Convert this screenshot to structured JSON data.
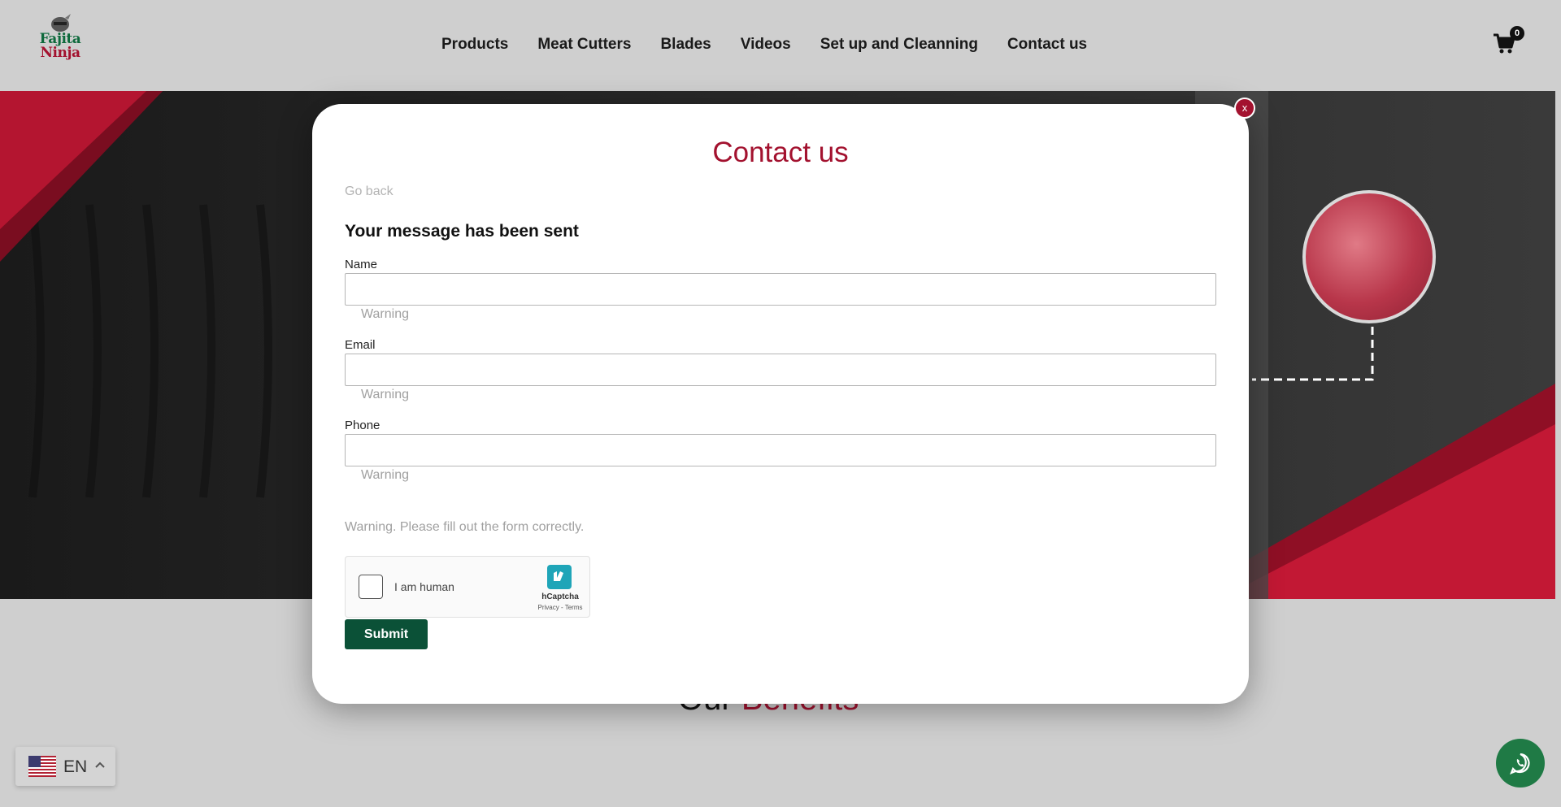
{
  "header": {
    "logo_line1": "Fajita",
    "logo_line2": "Ninja",
    "nav": [
      "Products",
      "Meat Cutters",
      "Blades",
      "Videos",
      "Set up and Cleanning",
      "Contact us"
    ],
    "cart_count": "0"
  },
  "modal": {
    "title": "Contact us",
    "go_back": "Go back",
    "sent_message": "Your message has been sent",
    "close_label": "x",
    "fields": [
      {
        "label": "Name",
        "value": "",
        "warning": "Warning"
      },
      {
        "label": "Email",
        "value": "",
        "warning": "Warning"
      },
      {
        "label": "Phone",
        "value": "",
        "warning": "Warning"
      }
    ],
    "form_warning": "Warning. Please fill out the form correctly.",
    "captcha": {
      "label": "I am human",
      "brand": "hCaptcha",
      "links": "Privacy - Terms"
    },
    "submit_label": "Submit"
  },
  "page": {
    "benefits_word1": "Our",
    "benefits_word2": "Benefits"
  },
  "language": {
    "code": "EN"
  },
  "colors": {
    "brand_red": "#a3122f",
    "brand_green": "#0b5137",
    "whatsapp_green": "#1f7a45"
  },
  "icons": [
    "cart-icon",
    "close-icon",
    "hcaptcha-icon",
    "us-flag-icon",
    "chevron-up-icon",
    "whatsapp-icon"
  ]
}
